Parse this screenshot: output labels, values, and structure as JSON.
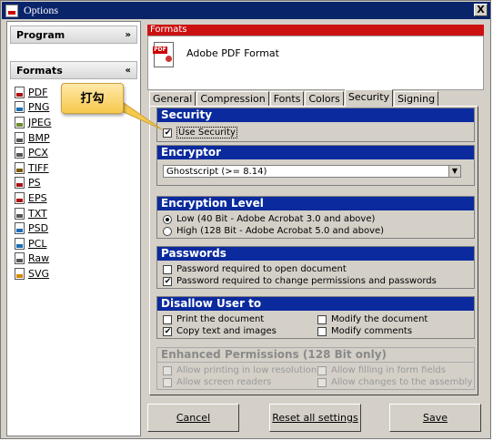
{
  "window": {
    "title": "Options",
    "close_label": "X"
  },
  "left": {
    "program_header": "Program",
    "program_chevron": "»",
    "formats_header": "Formats",
    "formats_chevron": "«",
    "formats": [
      {
        "label": "PDF",
        "color": "#aa1111"
      },
      {
        "label": "PNG",
        "color": "#1b6db5"
      },
      {
        "label": "JPEG",
        "color": "#6a8c2a"
      },
      {
        "label": "BMP",
        "color": "#555555"
      },
      {
        "label": "PCX",
        "color": "#555555"
      },
      {
        "label": "TIFF",
        "color": "#7a5a00"
      },
      {
        "label": "PS",
        "color": "#aa1111"
      },
      {
        "label": "EPS",
        "color": "#aa1111"
      },
      {
        "label": "TXT",
        "color": "#555555"
      },
      {
        "label": "PSD",
        "color": "#1b6db5"
      },
      {
        "label": "PCL",
        "color": "#1b6db5"
      },
      {
        "label": "Raw",
        "color": "#555555"
      },
      {
        "label": "SVG",
        "color": "#d08a00"
      }
    ]
  },
  "right": {
    "formats_strip": "Formats",
    "format_name": "Adobe PDF Format",
    "pdf_tag": "PDF",
    "tabs": [
      "General",
      "Compression",
      "Fonts",
      "Colors",
      "Security",
      "Signing"
    ],
    "active_tab": "Security",
    "security": {
      "title": "Security",
      "use_security": "Use Security"
    },
    "encryptor": {
      "title": "Encryptor",
      "selected": "Ghostscript (>= 8.14)"
    },
    "encryption_level": {
      "title": "Encryption Level",
      "low": "Low (40 Bit - Adobe Acrobat 3.0 and above)",
      "high": "High (128 Bit - Adobe Acrobat 5.0 and above)"
    },
    "passwords": {
      "title": "Passwords",
      "open": "Password required to open document",
      "change": "Password required to change permissions and passwords"
    },
    "disallow": {
      "title": "Disallow User to",
      "print": "Print the document",
      "modify": "Modify the document",
      "copy": "Copy text and images",
      "comments": "Modify comments"
    },
    "enhanced": {
      "title": "Enhanced Permissions (128 Bit only)",
      "print_low": "Allow printing in low resolution",
      "fill_forms": "Allow filling in form fields",
      "screen_readers": "Allow screen readers",
      "assembly": "Allow changes to the assembly"
    },
    "buttons": {
      "cancel": "Cancel",
      "reset": "Reset all settings",
      "save": "Save"
    }
  },
  "callout": {
    "text": "打勾"
  }
}
